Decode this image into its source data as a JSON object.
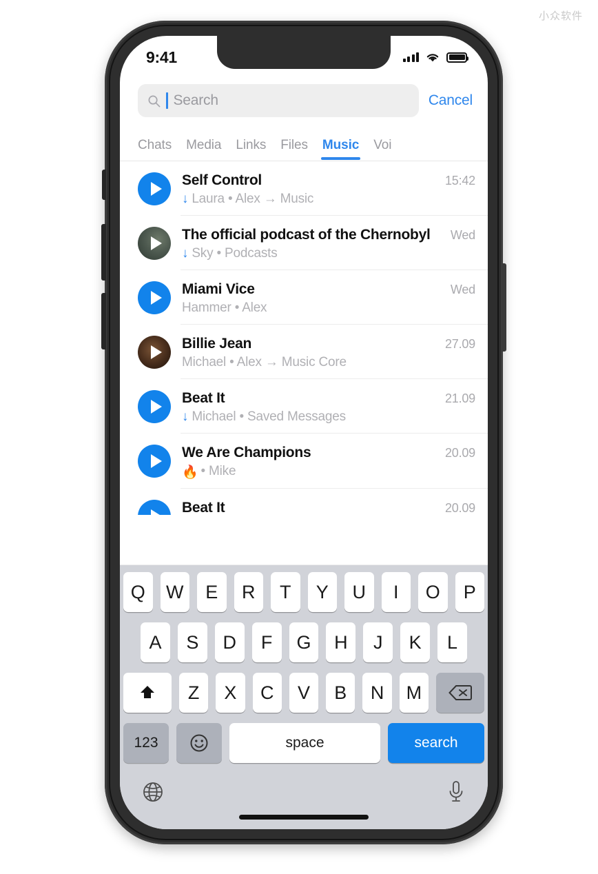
{
  "watermark": "小众软件",
  "status_bar": {
    "time": "9:41",
    "signal_icon": "signal-bars-icon",
    "wifi_icon": "wifi-icon",
    "battery_icon": "battery-full-icon"
  },
  "search": {
    "placeholder": "Search",
    "value": "",
    "icon": "search-icon",
    "cancel_label": "Cancel"
  },
  "tabs": [
    {
      "label": "Chats",
      "active": false
    },
    {
      "label": "Media",
      "active": false
    },
    {
      "label": "Links",
      "active": false
    },
    {
      "label": "Files",
      "active": false
    },
    {
      "label": "Music",
      "active": true
    },
    {
      "label": "Voi",
      "active": false
    }
  ],
  "results": [
    {
      "title": "Self Control",
      "subtitle": "Laura • Alex → Music",
      "time": "15:42",
      "thumb": "play-button-blue",
      "downloaded": true,
      "emoji": ""
    },
    {
      "title": "The official podcast of the Chernobyl",
      "subtitle": "Sky • Podcasts",
      "time": "Wed",
      "thumb": "photo-green",
      "downloaded": true,
      "emoji": ""
    },
    {
      "title": "Miami Vice",
      "subtitle": "Hammer • Alex",
      "time": "Wed",
      "thumb": "play-button-blue",
      "downloaded": false,
      "emoji": ""
    },
    {
      "title": "Billie Jean",
      "subtitle": "Michael • Alex → Music Core",
      "time": "27.09",
      "thumb": "photo-brown",
      "downloaded": false,
      "emoji": ""
    },
    {
      "title": "Beat It",
      "subtitle": "Michael • Saved Messages",
      "time": "21.09",
      "thumb": "play-button-blue",
      "downloaded": true,
      "emoji": ""
    },
    {
      "title": "We Are Champions",
      "subtitle": "• Mike",
      "time": "20.09",
      "thumb": "play-button-blue",
      "downloaded": false,
      "emoji": "🔥"
    },
    {
      "title": "Beat It",
      "subtitle": "",
      "time": "20.09",
      "thumb": "play-button-blue",
      "downloaded": false,
      "emoji": ""
    }
  ],
  "keyboard": {
    "row1": [
      "Q",
      "W",
      "E",
      "R",
      "T",
      "Y",
      "U",
      "I",
      "O",
      "P"
    ],
    "row2": [
      "A",
      "S",
      "D",
      "F",
      "G",
      "H",
      "J",
      "K",
      "L"
    ],
    "row3": [
      "Z",
      "X",
      "C",
      "V",
      "B",
      "N",
      "M"
    ],
    "shift_icon": "shift-arrow-up-icon",
    "backspace_icon": "backspace-delete-icon",
    "numbers_label": "123",
    "emoji_icon": "emoji-smiley-icon",
    "space_label": "space",
    "search_label": "search",
    "globe_icon": "globe-language-icon",
    "mic_icon": "microphone-icon"
  },
  "colors": {
    "accent": "#2f87ec",
    "telegram_blue": "#1283eb",
    "keyboard_bg": "#d1d3d9",
    "subtitle_gray": "#b0b0b4",
    "device_frame": "#2e2e2e"
  }
}
